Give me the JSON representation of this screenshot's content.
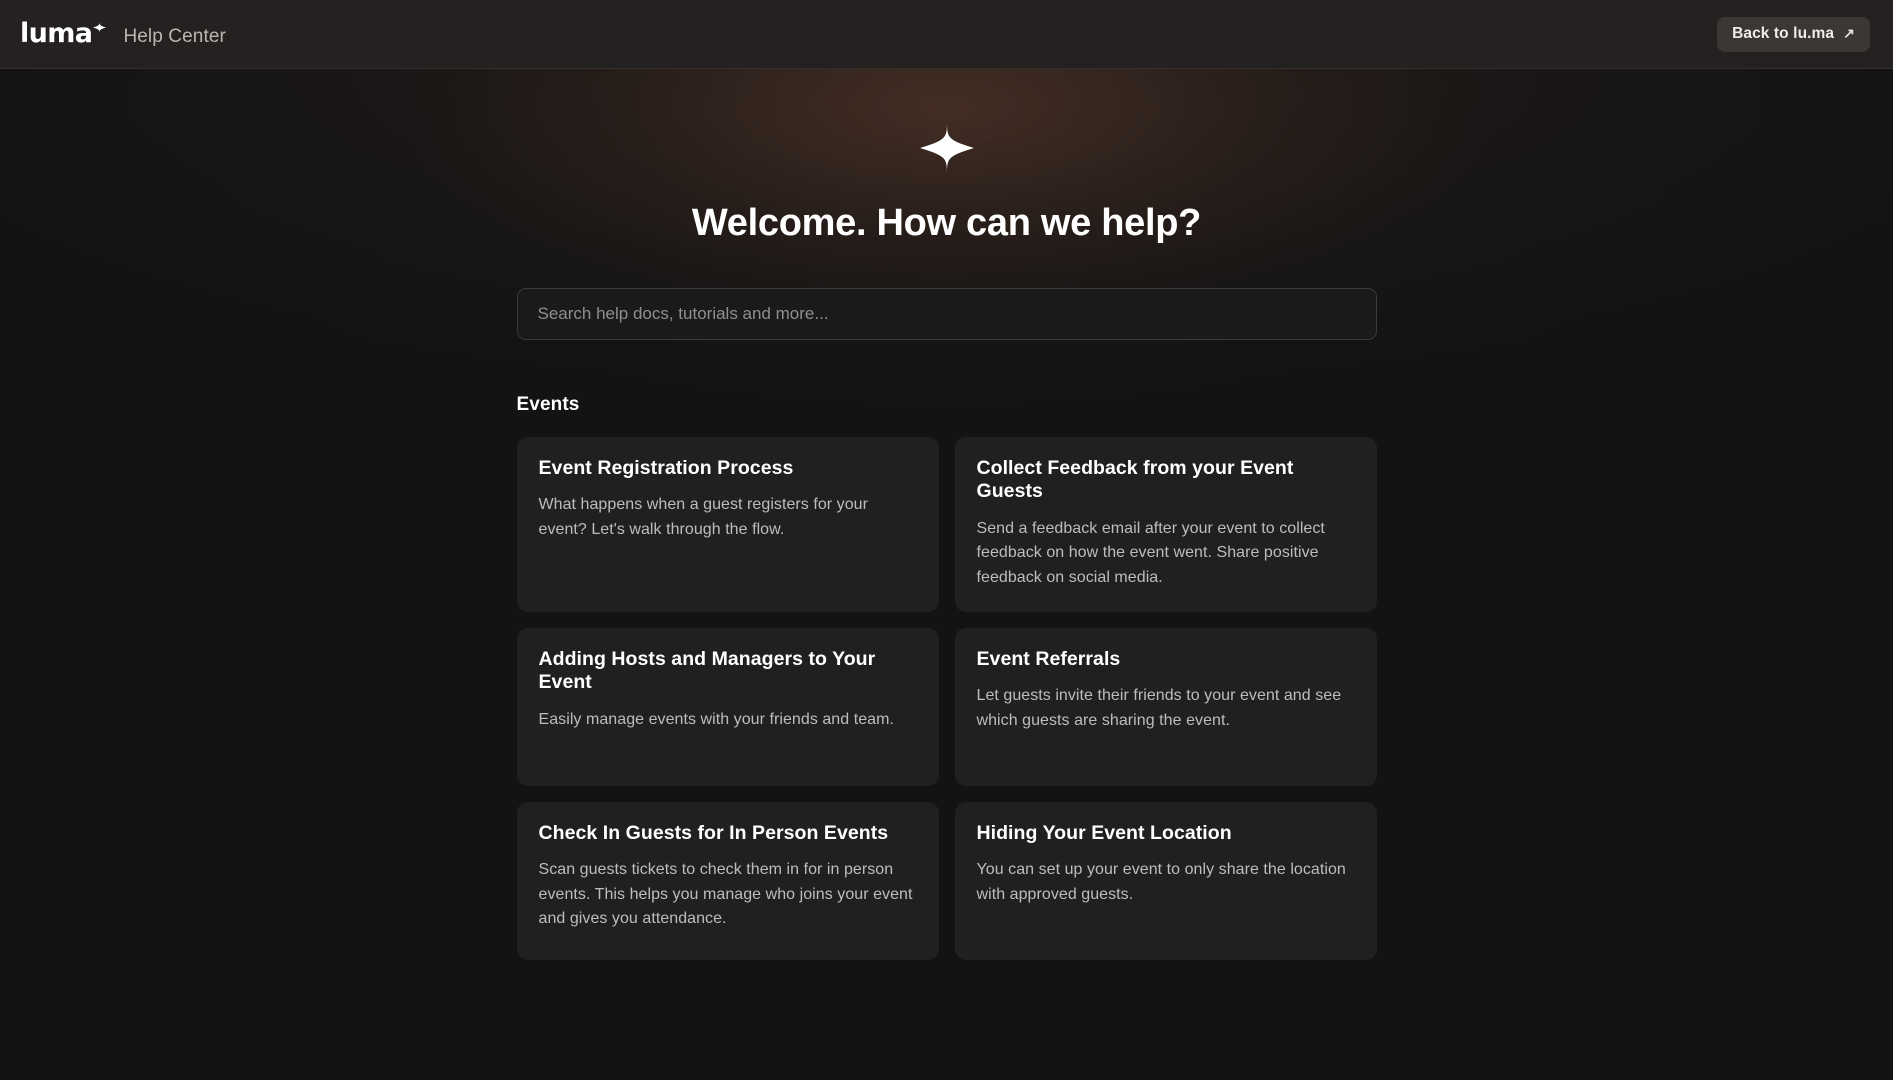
{
  "header": {
    "logo_text": "luma",
    "logo_sparkle_icon": "sparkle-icon",
    "site_title": "Help Center",
    "back_button_label": "Back to lu.ma",
    "back_button_icon": "external-link-arrow-icon"
  },
  "hero": {
    "sparkle_icon": "sparkle-icon",
    "title": "Welcome. How can we help?"
  },
  "search": {
    "placeholder": "Search help docs, tutorials and more...",
    "value": ""
  },
  "sections": [
    {
      "title": "Events",
      "cards": [
        {
          "title": "Event Registration Process",
          "description": "What happens when a guest registers for your event? Let's walk through the flow."
        },
        {
          "title": "Collect Feedback from your Event Guests",
          "description": "Send a feedback email after your event to collect feedback on how the event went. Share positive feedback on social media."
        },
        {
          "title": "Adding Hosts and Managers to Your Event",
          "description": "Easily manage events with your friends and team."
        },
        {
          "title": "Event Referrals",
          "description": "Let guests invite their friends to your event and see which guests are sharing the event."
        },
        {
          "title": "Check In Guests for In Person Events",
          "description": "Scan guests tickets to check them in for in person events. This helps you manage who joins your event and gives you attendance."
        },
        {
          "title": "Hiding Your Event Location",
          "description": "You can set up your event to only share the location with approved guests."
        }
      ]
    }
  ],
  "colors": {
    "page_background": "#131314",
    "header_background": "#242120",
    "card_background": "#1f2022",
    "accent_glow": "#6a4230",
    "text_primary": "#ffffff",
    "text_secondary": "#bcbdbe"
  }
}
